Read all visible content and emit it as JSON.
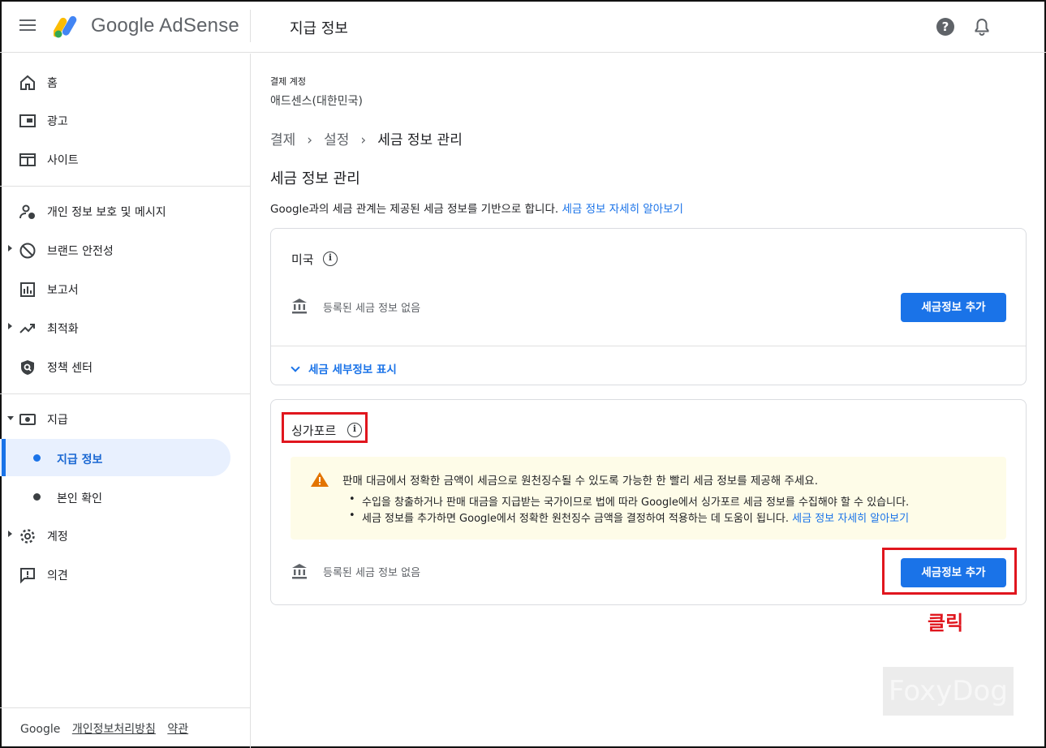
{
  "header": {
    "brand": "Google AdSense",
    "page_title": "지급 정보",
    "help_icon": "help-icon",
    "bell_icon": "bell-icon"
  },
  "sidebar": {
    "items": [
      {
        "label": "홈",
        "icon": "home-icon"
      },
      {
        "label": "광고",
        "icon": "ads-icon"
      },
      {
        "label": "사이트",
        "icon": "sites-icon"
      },
      {
        "label": "개인 정보 보호 및 메시지",
        "icon": "privacy-icon"
      },
      {
        "label": "브랜드 안전성",
        "icon": "block-icon"
      },
      {
        "label": "보고서",
        "icon": "reports-icon"
      },
      {
        "label": "최적화",
        "icon": "trending-icon"
      },
      {
        "label": "정책 센터",
        "icon": "policy-shield-icon"
      },
      {
        "label": "지급",
        "icon": "payments-icon"
      },
      {
        "label": "계정",
        "icon": "gear-icon"
      },
      {
        "label": "의견",
        "icon": "feedback-icon"
      }
    ],
    "sub_items": [
      {
        "label": "지급 정보",
        "active": true
      },
      {
        "label": "본인 확인",
        "active": false
      }
    ],
    "footer": {
      "brand": "Google",
      "privacy_link": "개인정보처리방침",
      "terms_link": "약관"
    }
  },
  "main": {
    "account_label": "결제 계정",
    "account_value": "애드센스(대한민국)",
    "breadcrumb": [
      "결제",
      "설정",
      "세금 정보 관리"
    ],
    "title": "세금 정보 관리",
    "description": "Google과의 세금 관계는 제공된 세금 정보를 기반으로 합니다.",
    "description_link": "세금 정보 자세히 알아보기",
    "cards": [
      {
        "country": "미국",
        "status": "등록된 세금 정보 없음",
        "button": "세금정보 추가",
        "expand_label": "세금 세부정보 표시"
      },
      {
        "country": "싱가포르",
        "warning_title": "판매 대금에서 정확한 금액이 세금으로 원천징수될 수 있도록 가능한 한 빨리 세금 정보를 제공해 주세요.",
        "warning_items": [
          "수입을 창출하거나 판매 대금을 지급받는 국가이므로 법에 따라 Google에서 싱가포르 세금 정보를 수집해야 할 수 있습니다.",
          "세금 정보를 추가하면 Google에서 정확한 원천징수 금액을 결정하여 적용하는 데 도움이 됩니다."
        ],
        "warning_link": "세금 정보 자세히 알아보기",
        "status": "등록된 세금 정보 없음",
        "button": "세금정보 추가"
      }
    ]
  },
  "annotation": {
    "click_label": "클릭",
    "color": "#e0161e"
  },
  "watermark": "FoxyDog",
  "colors": {
    "accent": "#1a73e8",
    "warning_bg": "#fefce8",
    "warning_icon": "#e37400"
  }
}
